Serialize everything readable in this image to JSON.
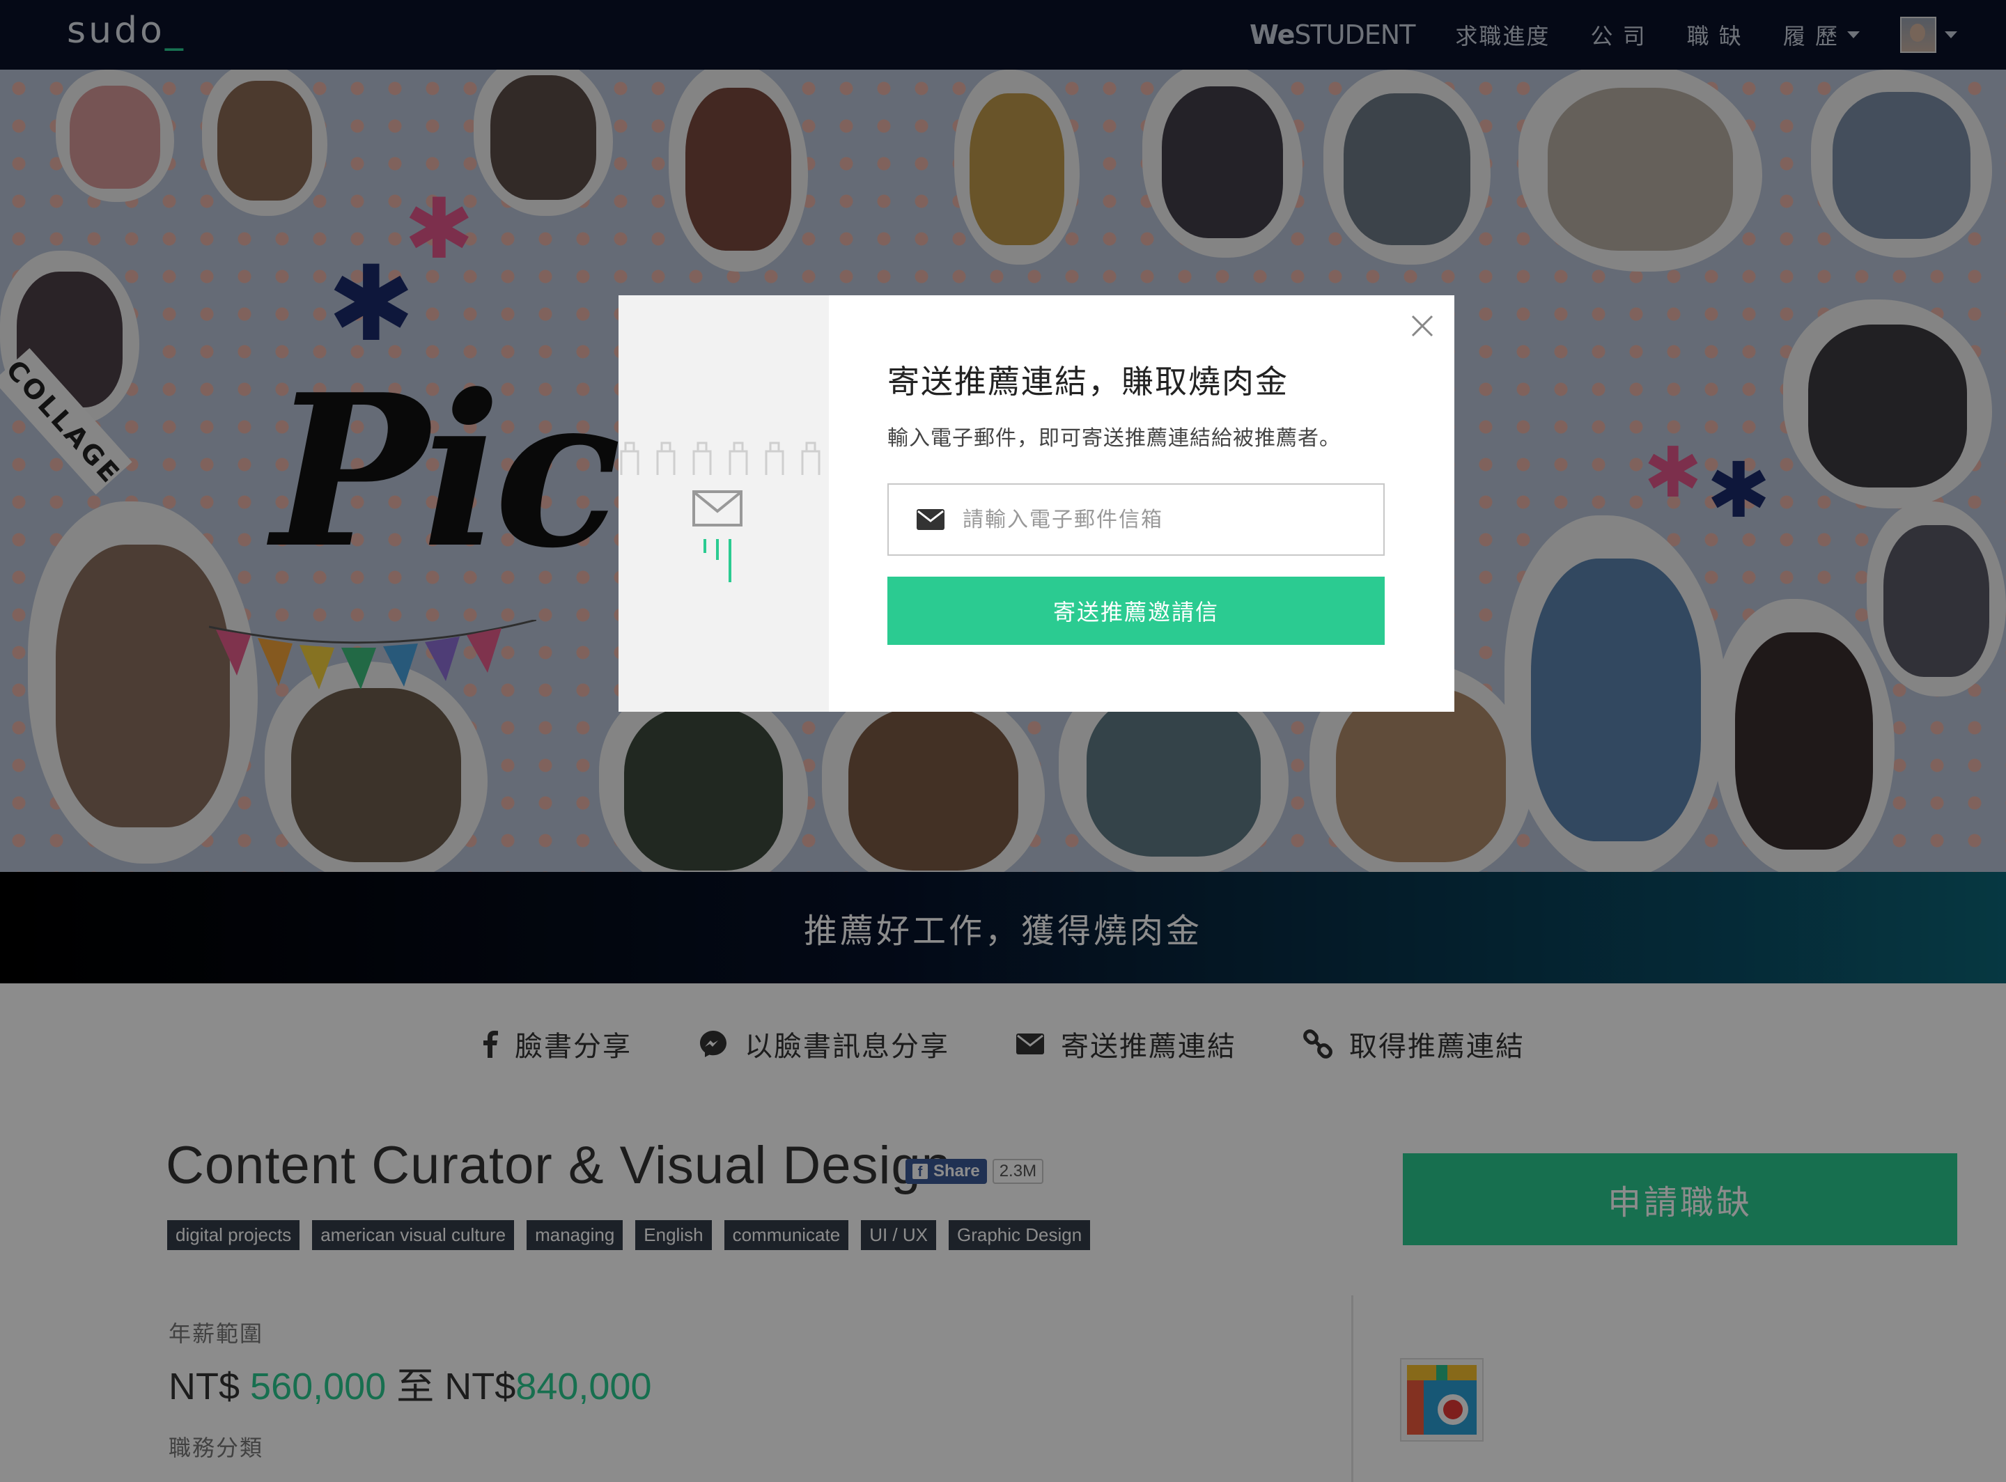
{
  "navbar": {
    "logo": "sudo",
    "logo_cursor": "_",
    "brand_bold": "We",
    "brand_rest": "STUDENT",
    "items": [
      "求職進度",
      "公 司",
      "職 缺",
      "履 歷"
    ]
  },
  "hero": {
    "pic_text": "PicC",
    "collage_sign": "COLLAGE"
  },
  "banner": {
    "text": "推薦好工作，獲得燒肉金"
  },
  "share_bar": {
    "facebook": "臉書分享",
    "messenger": "以臉書訊息分享",
    "email": "寄送推薦連結",
    "link": "取得推薦連結"
  },
  "job": {
    "title": "Content Curator & Visual Design",
    "fb_share_label": "Share",
    "fb_share_count": "2.3M",
    "tags": [
      "digital projects",
      "american visual culture",
      "managing",
      "English",
      "communicate",
      "UI / UX",
      "Graphic Design"
    ],
    "apply_label": "申請職缺",
    "salary_label": "年薪範圍",
    "salary_currency_1": "NT$",
    "salary_min": "560,000",
    "salary_to": "至",
    "salary_currency_2": "NT$",
    "salary_max": "840,000",
    "category_label": "職務分類"
  },
  "modal": {
    "title": "寄送推薦連結，賺取燒肉金",
    "subtitle": "輸入電子郵件，即可寄送推薦連結給被推薦者。",
    "email_placeholder": "請輸入電子郵件信箱",
    "email_value": "",
    "send_label": "寄送推薦邀請信"
  },
  "colors": {
    "accent": "#2bcb91",
    "navbar": "#0a1128",
    "tag_bg": "#333d4a",
    "facebook": "#3b5998"
  },
  "icons": [
    "facebook-icon",
    "messenger-icon",
    "envelope-icon",
    "link-icon",
    "close-icon",
    "caret-down-icon"
  ]
}
